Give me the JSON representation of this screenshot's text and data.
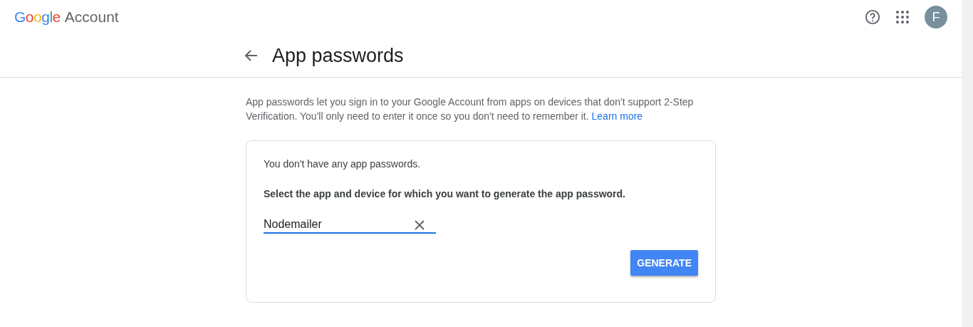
{
  "header": {
    "brand": "Google",
    "product": "Account",
    "avatar": "F"
  },
  "page": {
    "title": "App passwords",
    "intro": "App passwords let you sign in to your Google Account from apps on devices that don't support 2-Step Verification. You'll only need to enter it once so you don't need to remember it.",
    "learn_more": "Learn more"
  },
  "card": {
    "status": "You don't have any app passwords.",
    "prompt": "Select the app and device for which you want to generate the app password.",
    "field": {
      "value": "Nodemailer",
      "focused": true
    },
    "button": "GENERATE"
  }
}
